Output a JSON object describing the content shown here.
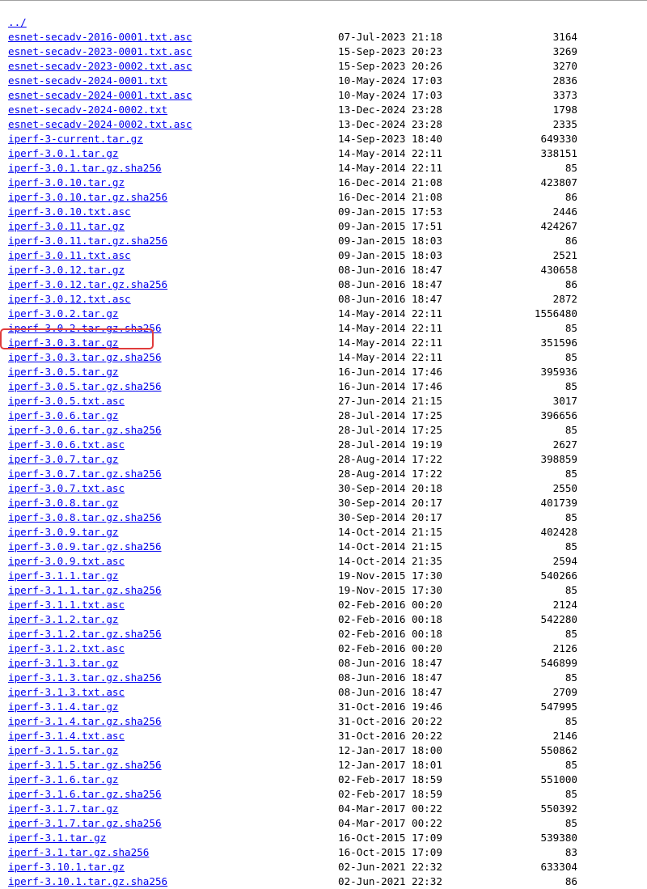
{
  "parent_link": "../",
  "entries": [
    {
      "name": "esnet-secadv-2016-0001.txt.asc",
      "date": "07-Jul-2023 21:18",
      "size": "3164"
    },
    {
      "name": "esnet-secadv-2023-0001.txt.asc",
      "date": "15-Sep-2023 20:23",
      "size": "3269"
    },
    {
      "name": "esnet-secadv-2023-0002.txt.asc",
      "date": "15-Sep-2023 20:26",
      "size": "3270"
    },
    {
      "name": "esnet-secadv-2024-0001.txt",
      "date": "10-May-2024 17:03",
      "size": "2836"
    },
    {
      "name": "esnet-secadv-2024-0001.txt.asc",
      "date": "10-May-2024 17:03",
      "size": "3373"
    },
    {
      "name": "esnet-secadv-2024-0002.txt",
      "date": "13-Dec-2024 23:28",
      "size": "1798"
    },
    {
      "name": "esnet-secadv-2024-0002.txt.asc",
      "date": "13-Dec-2024 23:28",
      "size": "2335"
    },
    {
      "name": "iperf-3-current.tar.gz",
      "date": "14-Sep-2023 18:40",
      "size": "649330"
    },
    {
      "name": "iperf-3.0.1.tar.gz",
      "date": "14-May-2014 22:11",
      "size": "338151"
    },
    {
      "name": "iperf-3.0.1.tar.gz.sha256",
      "date": "14-May-2014 22:11",
      "size": "85"
    },
    {
      "name": "iperf-3.0.10.tar.gz",
      "date": "16-Dec-2014 21:08",
      "size": "423807"
    },
    {
      "name": "iperf-3.0.10.tar.gz.sha256",
      "date": "16-Dec-2014 21:08",
      "size": "86"
    },
    {
      "name": "iperf-3.0.10.txt.asc",
      "date": "09-Jan-2015 17:53",
      "size": "2446"
    },
    {
      "name": "iperf-3.0.11.tar.gz",
      "date": "09-Jan-2015 17:51",
      "size": "424267"
    },
    {
      "name": "iperf-3.0.11.tar.gz.sha256",
      "date": "09-Jan-2015 18:03",
      "size": "86"
    },
    {
      "name": "iperf-3.0.11.txt.asc",
      "date": "09-Jan-2015 18:03",
      "size": "2521"
    },
    {
      "name": "iperf-3.0.12.tar.gz",
      "date": "08-Jun-2016 18:47",
      "size": "430658"
    },
    {
      "name": "iperf-3.0.12.tar.gz.sha256",
      "date": "08-Jun-2016 18:47",
      "size": "86"
    },
    {
      "name": "iperf-3.0.12.txt.asc",
      "date": "08-Jun-2016 18:47",
      "size": "2872"
    },
    {
      "name": "iperf-3.0.2.tar.gz",
      "date": "14-May-2014 22:11",
      "size": "1556480"
    },
    {
      "name": "iperf-3.0.2.tar.gz.sha256",
      "date": "14-May-2014 22:11",
      "size": "85"
    },
    {
      "name": "iperf-3.0.3.tar.gz",
      "date": "14-May-2014 22:11",
      "size": "351596"
    },
    {
      "name": "iperf-3.0.3.tar.gz.sha256",
      "date": "14-May-2014 22:11",
      "size": "85"
    },
    {
      "name": "iperf-3.0.5.tar.gz",
      "date": "16-Jun-2014 17:46",
      "size": "395936"
    },
    {
      "name": "iperf-3.0.5.tar.gz.sha256",
      "date": "16-Jun-2014 17:46",
      "size": "85"
    },
    {
      "name": "iperf-3.0.5.txt.asc",
      "date": "27-Jun-2014 21:15",
      "size": "3017"
    },
    {
      "name": "iperf-3.0.6.tar.gz",
      "date": "28-Jul-2014 17:25",
      "size": "396656"
    },
    {
      "name": "iperf-3.0.6.tar.gz.sha256",
      "date": "28-Jul-2014 17:25",
      "size": "85"
    },
    {
      "name": "iperf-3.0.6.txt.asc",
      "date": "28-Jul-2014 19:19",
      "size": "2627"
    },
    {
      "name": "iperf-3.0.7.tar.gz",
      "date": "28-Aug-2014 17:22",
      "size": "398859"
    },
    {
      "name": "iperf-3.0.7.tar.gz.sha256",
      "date": "28-Aug-2014 17:22",
      "size": "85"
    },
    {
      "name": "iperf-3.0.7.txt.asc",
      "date": "30-Sep-2014 20:18",
      "size": "2550"
    },
    {
      "name": "iperf-3.0.8.tar.gz",
      "date": "30-Sep-2014 20:17",
      "size": "401739"
    },
    {
      "name": "iperf-3.0.8.tar.gz.sha256",
      "date": "30-Sep-2014 20:17",
      "size": "85"
    },
    {
      "name": "iperf-3.0.9.tar.gz",
      "date": "14-Oct-2014 21:15",
      "size": "402428"
    },
    {
      "name": "iperf-3.0.9.tar.gz.sha256",
      "date": "14-Oct-2014 21:15",
      "size": "85"
    },
    {
      "name": "iperf-3.0.9.txt.asc",
      "date": "14-Oct-2014 21:35",
      "size": "2594"
    },
    {
      "name": "iperf-3.1.1.tar.gz",
      "date": "19-Nov-2015 17:30",
      "size": "540266"
    },
    {
      "name": "iperf-3.1.1.tar.gz.sha256",
      "date": "19-Nov-2015 17:30",
      "size": "85"
    },
    {
      "name": "iperf-3.1.1.txt.asc",
      "date": "02-Feb-2016 00:20",
      "size": "2124"
    },
    {
      "name": "iperf-3.1.2.tar.gz",
      "date": "02-Feb-2016 00:18",
      "size": "542280"
    },
    {
      "name": "iperf-3.1.2.tar.gz.sha256",
      "date": "02-Feb-2016 00:18",
      "size": "85"
    },
    {
      "name": "iperf-3.1.2.txt.asc",
      "date": "02-Feb-2016 00:20",
      "size": "2126"
    },
    {
      "name": "iperf-3.1.3.tar.gz",
      "date": "08-Jun-2016 18:47",
      "size": "546899"
    },
    {
      "name": "iperf-3.1.3.tar.gz.sha256",
      "date": "08-Jun-2016 18:47",
      "size": "85"
    },
    {
      "name": "iperf-3.1.3.txt.asc",
      "date": "08-Jun-2016 18:47",
      "size": "2709"
    },
    {
      "name": "iperf-3.1.4.tar.gz",
      "date": "31-Oct-2016 19:46",
      "size": "547995"
    },
    {
      "name": "iperf-3.1.4.tar.gz.sha256",
      "date": "31-Oct-2016 20:22",
      "size": "85"
    },
    {
      "name": "iperf-3.1.4.txt.asc",
      "date": "31-Oct-2016 20:22",
      "size": "2146"
    },
    {
      "name": "iperf-3.1.5.tar.gz",
      "date": "12-Jan-2017 18:00",
      "size": "550862"
    },
    {
      "name": "iperf-3.1.5.tar.gz.sha256",
      "date": "12-Jan-2017 18:01",
      "size": "85"
    },
    {
      "name": "iperf-3.1.6.tar.gz",
      "date": "02-Feb-2017 18:59",
      "size": "551000"
    },
    {
      "name": "iperf-3.1.6.tar.gz.sha256",
      "date": "02-Feb-2017 18:59",
      "size": "85"
    },
    {
      "name": "iperf-3.1.7.tar.gz",
      "date": "04-Mar-2017 00:22",
      "size": "550392"
    },
    {
      "name": "iperf-3.1.7.tar.gz.sha256",
      "date": "04-Mar-2017 00:22",
      "size": "85"
    },
    {
      "name": "iperf-3.1.tar.gz",
      "date": "16-Oct-2015 17:09",
      "size": "539380"
    },
    {
      "name": "iperf-3.1.tar.gz.sha256",
      "date": "16-Oct-2015 17:09",
      "size": "83"
    },
    {
      "name": "iperf-3.10.1.tar.gz",
      "date": "02-Jun-2021 22:32",
      "size": "633304"
    },
    {
      "name": "iperf-3.10.1.tar.gz.sha256",
      "date": "02-Jun-2021 22:32",
      "size": "86"
    }
  ],
  "highlight": {
    "entry": "iperf-3.0.3.tar.gz",
    "color": "#e03c3c"
  },
  "colors": {
    "link": "#0000ee",
    "text": "#000000",
    "background": "#ffffff"
  }
}
